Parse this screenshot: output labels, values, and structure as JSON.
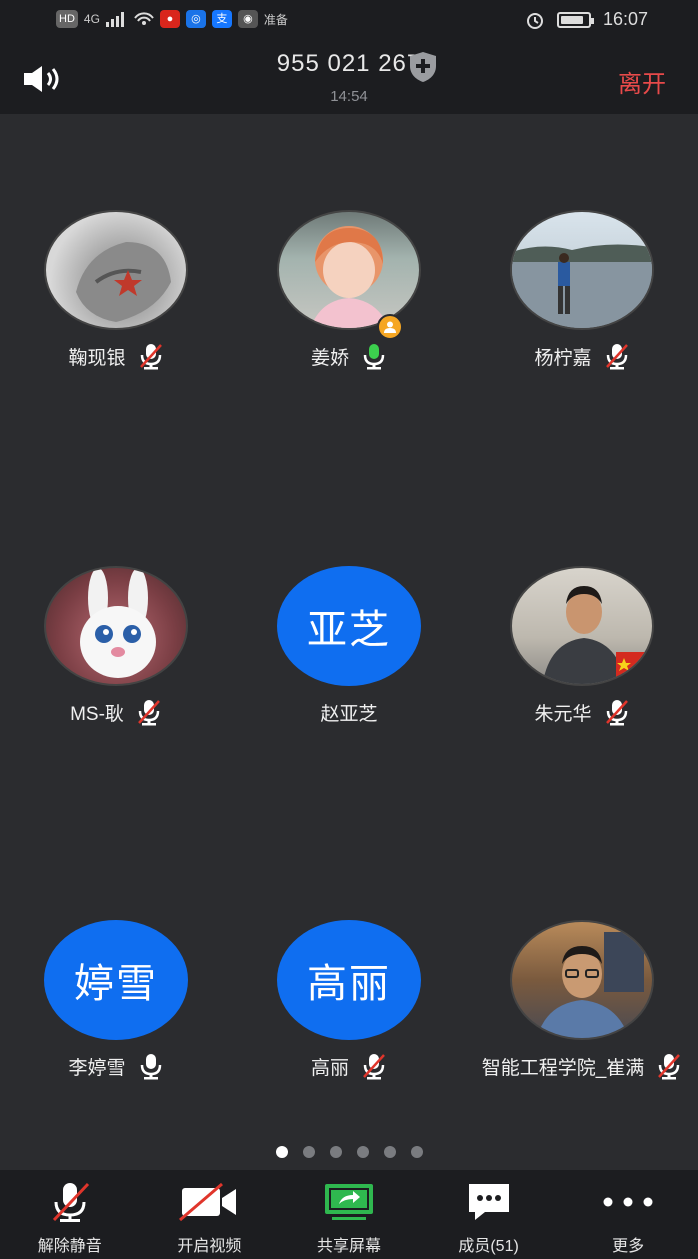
{
  "status_bar": {
    "left_chips": [
      "HD",
      "4G"
    ],
    "carrier_text": "准备",
    "time": "16:07",
    "battery_level": 0.85
  },
  "header": {
    "meeting_id": "955 021 267",
    "elapsed": "14:54",
    "leave_label": "离开"
  },
  "participants": [
    {
      "name": "鞠现银",
      "avatar": "photo",
      "mic": "muted"
    },
    {
      "name": "姜娇",
      "avatar": "photo",
      "mic": "active",
      "host": true
    },
    {
      "name": "杨柠嘉",
      "avatar": "photo",
      "mic": "muted"
    },
    {
      "name": "MS-耿",
      "avatar": "photo",
      "mic": "muted"
    },
    {
      "name": "赵亚芝",
      "avatar_text": "亚芝",
      "mic": "none"
    },
    {
      "name": "朱元华",
      "avatar": "photo",
      "mic": "muted"
    },
    {
      "name": "李婷雪",
      "avatar_text": "婷雪",
      "mic": "on"
    },
    {
      "name": "高丽",
      "avatar_text": "高丽",
      "mic": "muted"
    },
    {
      "name": "智能工程学院_崔满",
      "avatar": "photo",
      "mic": "muted"
    }
  ],
  "pager": {
    "pages": 6,
    "current": 1
  },
  "toolbar": {
    "unmute_label": "解除静音",
    "video_label": "开启视频",
    "share_label": "共享屏幕",
    "members_label": "成员(51)",
    "more_label": "更多"
  },
  "colors": {
    "accent_blue": "#0f6ef0",
    "leave_red": "#e84a4a",
    "mic_green": "#3ccf4e",
    "share_green": "#2fb84f"
  }
}
